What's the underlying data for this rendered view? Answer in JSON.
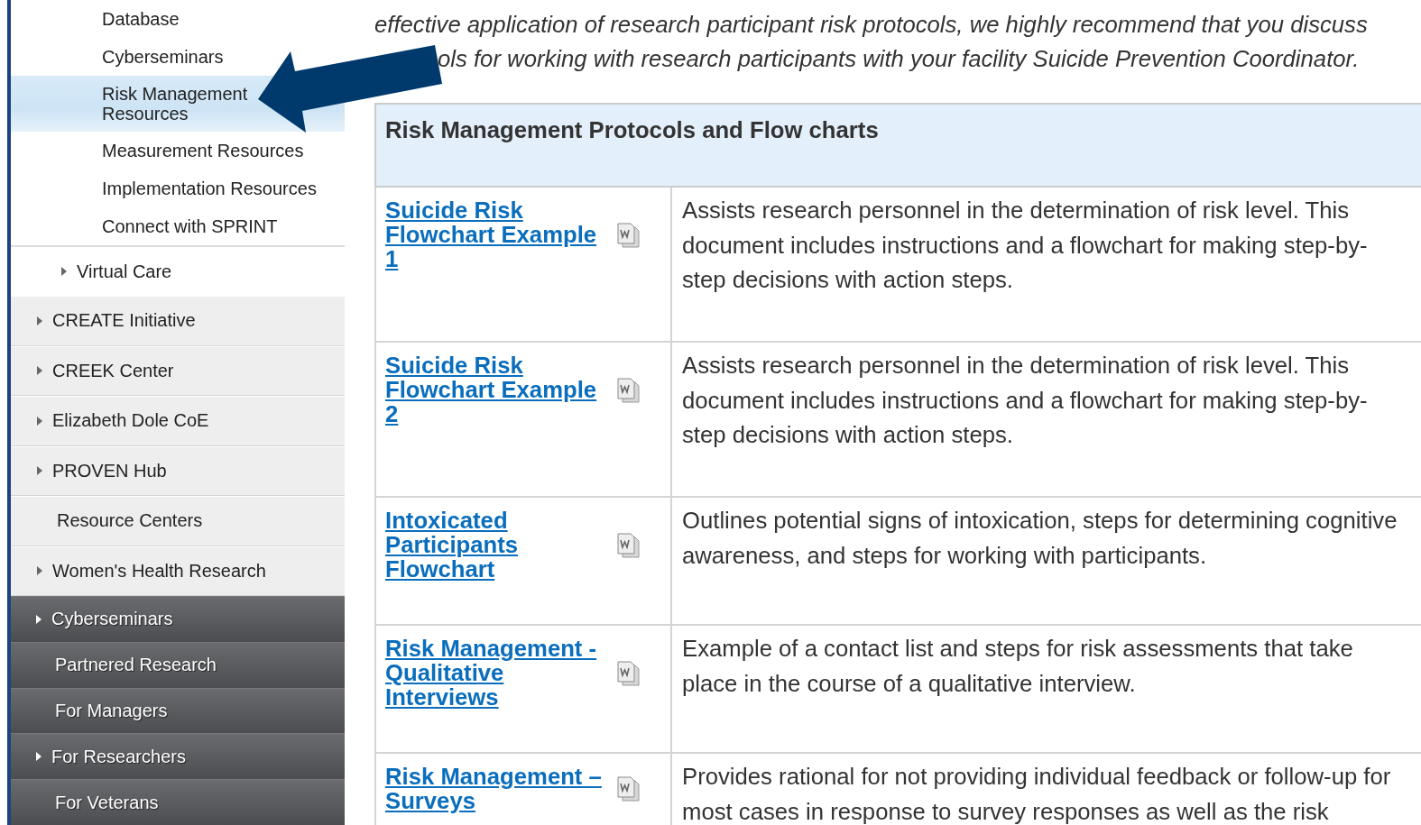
{
  "sidebar": {
    "items": [
      {
        "label": "Database",
        "kind": "sub",
        "expandable": false,
        "selected": false
      },
      {
        "label": "Cyberseminars",
        "kind": "sub",
        "expandable": false,
        "selected": false
      },
      {
        "label": "Risk Management Resources",
        "kind": "sub",
        "expandable": false,
        "selected": true
      },
      {
        "label": "Measurement Resources",
        "kind": "sub",
        "expandable": false,
        "selected": false
      },
      {
        "label": "Implementation Resources",
        "kind": "sub",
        "expandable": false,
        "selected": false
      },
      {
        "label": "Connect with SPRINT",
        "kind": "sub",
        "expandable": false,
        "selected": false
      },
      {
        "label": "Virtual Care",
        "kind": "section",
        "expandable": true,
        "selected": false
      },
      {
        "label": "CREATE Initiative",
        "kind": "group",
        "expandable": true,
        "selected": false
      },
      {
        "label": "CREEK Center",
        "kind": "group",
        "expandable": true,
        "selected": false
      },
      {
        "label": "Elizabeth Dole CoE",
        "kind": "group",
        "expandable": true,
        "selected": false
      },
      {
        "label": "PROVEN Hub",
        "kind": "group",
        "expandable": true,
        "selected": false
      },
      {
        "label": "Resource Centers",
        "kind": "group",
        "expandable": false,
        "selected": false
      },
      {
        "label": "Women's Health Research",
        "kind": "group",
        "expandable": true,
        "selected": false
      },
      {
        "label": "Cyberseminars",
        "kind": "main",
        "expandable": true,
        "selected": false
      },
      {
        "label": "Partnered Research",
        "kind": "main",
        "expandable": false,
        "selected": false
      },
      {
        "label": "For Managers",
        "kind": "main",
        "expandable": false,
        "selected": false
      },
      {
        "label": "For Researchers",
        "kind": "main",
        "expandable": true,
        "selected": false
      },
      {
        "label": "For Veterans",
        "kind": "main",
        "expandable": false,
        "selected": false
      }
    ]
  },
  "intro_lines": [
    "effective application of research participant risk protocols, we highly recommend that you discuss",
    "ols for working with research participants with your facility Suicide Prevention Coordinator."
  ],
  "table": {
    "title": "Risk Management Protocols and Flow charts",
    "rows": [
      {
        "link": "Suicide Risk Flowchart Example 1",
        "description": "Assists research personnel in the determination of risk level. This document includes instructions and a flowchart for making step-by-step decisions with action steps."
      },
      {
        "link": "Suicide Risk Flowchart Example 2",
        "description": "Assists research personnel in the determination of risk level. This document includes instructions and a flowchart for making step-by-step decisions with action steps."
      },
      {
        "link": "Intoxicated Participants Flowchart",
        "description": "Outlines potential signs of intoxication, steps for determining cognitive awareness, and steps for working with participants."
      },
      {
        "link": "Risk Management - Qualitative Interviews",
        "description": "Example of a contact list and steps for risk assessments that take place in the course of a qualitative interview."
      },
      {
        "link": "Risk Management – Surveys",
        "description": "Provides rational for not providing individual feedback or follow-up for most cases in response to survey responses as well as the risk"
      }
    ]
  }
}
